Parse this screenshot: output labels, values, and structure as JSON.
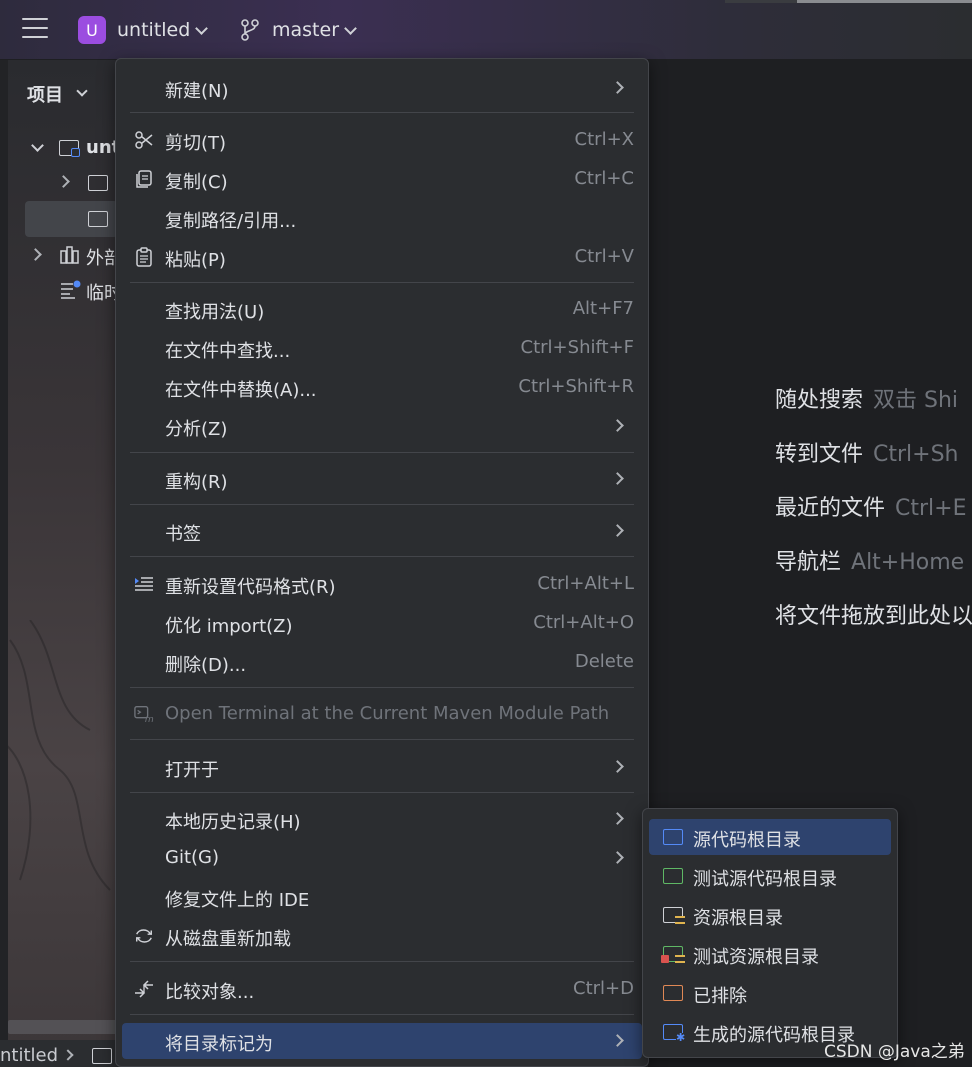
{
  "titlebar": {
    "project_badge": "U",
    "project_name": "untitled",
    "branch_name": "master"
  },
  "project_panel": {
    "title": "项目",
    "tree": [
      {
        "label": "unt"
      },
      {
        "label": "外部"
      },
      {
        "label": "临时"
      }
    ]
  },
  "status_bar": {
    "breadcrumb": "ntitled"
  },
  "editor_hints": [
    {
      "label": "随处搜索",
      "shortcut": "双击 Shi"
    },
    {
      "label": "转到文件",
      "shortcut": "Ctrl+Sh"
    },
    {
      "label": "最近的文件",
      "shortcut": "Ctrl+E"
    },
    {
      "label": "导航栏",
      "shortcut": "Alt+Home"
    },
    {
      "label": "将文件拖放到此处以",
      "shortcut": ""
    }
  ],
  "context_menu": {
    "items": [
      {
        "label": "新建(N)",
        "shortcut": "",
        "submenu": true,
        "icon": ""
      },
      {
        "label": "剪切(T)",
        "shortcut": "Ctrl+X",
        "icon": "scissors-icon"
      },
      {
        "label": "复制(C)",
        "shortcut": "Ctrl+C",
        "icon": "copy-icon"
      },
      {
        "label": "复制路径/引用...",
        "shortcut": ""
      },
      {
        "label": "粘贴(P)",
        "shortcut": "Ctrl+V",
        "icon": "clipboard-icon"
      },
      {
        "label": "查找用法(U)",
        "shortcut": "Alt+F7"
      },
      {
        "label": "在文件中查找...",
        "shortcut": "Ctrl+Shift+F"
      },
      {
        "label": "在文件中替换(A)...",
        "shortcut": "Ctrl+Shift+R"
      },
      {
        "label": "分析(Z)",
        "submenu": true
      },
      {
        "label": "重构(R)",
        "submenu": true
      },
      {
        "label": "书签",
        "submenu": true
      },
      {
        "label": "重新设置代码格式(R)",
        "shortcut": "Ctrl+Alt+L",
        "icon": "reformat-icon"
      },
      {
        "label": "优化 import(Z)",
        "shortcut": "Ctrl+Alt+O"
      },
      {
        "label": "删除(D)...",
        "shortcut": "Delete"
      },
      {
        "label": "Open Terminal at the Current Maven Module Path",
        "disabled": true,
        "icon": "maven-terminal-icon"
      },
      {
        "label": "打开于",
        "submenu": true
      },
      {
        "label": "本地历史记录(H)",
        "submenu": true
      },
      {
        "label": "Git(G)",
        "submenu": true
      },
      {
        "label": "修复文件上的 IDE"
      },
      {
        "label": "从磁盘重新加载",
        "icon": "reload-icon"
      },
      {
        "label": "比较对象...",
        "shortcut": "Ctrl+D",
        "icon": "compare-icon"
      },
      {
        "label": "将目录标记为",
        "submenu": true,
        "active": true
      }
    ]
  },
  "mark_directory_submenu": {
    "items": [
      {
        "label": "源代码根目录",
        "color": "#548af7",
        "active": true
      },
      {
        "label": "测试源代码根目录",
        "color": "#5fb865"
      },
      {
        "label": "资源根目录",
        "color": "#cfd1d6"
      },
      {
        "label": "测试资源根目录",
        "color": "#5fb865"
      },
      {
        "label": "已排除",
        "color": "#e08855"
      },
      {
        "label": "生成的源代码根目录",
        "color": "#548af7"
      }
    ]
  },
  "watermark": "CSDN @Java之弟"
}
